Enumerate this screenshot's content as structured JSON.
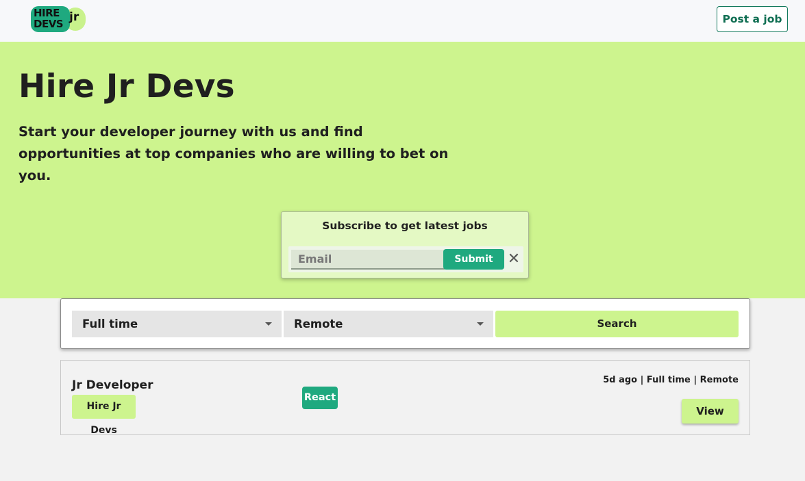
{
  "header": {
    "logo_text_line1": "HIRE",
    "logo_text_line2": "DEVS",
    "logo_badge": "jr",
    "post_job_label": "Post a job"
  },
  "hero": {
    "title": "Hire Jr Devs",
    "subtitle": "Start your developer journey with us and find opportunities at top companies who are willing to bet on you."
  },
  "subscribe": {
    "title": "Subscribe to get latest jobs",
    "email_placeholder": "Email",
    "email_value": "",
    "submit_label": "Submit",
    "close_icon": "close-icon"
  },
  "filters": {
    "job_type": "Full time",
    "location": "Remote",
    "search_label": "Search"
  },
  "jobs": [
    {
      "title": "Jr Developer",
      "company": "Hire Jr Devs",
      "tags": [
        "React"
      ],
      "meta": "5d ago | Full time | Remote",
      "view_label": "View"
    }
  ],
  "colors": {
    "accent_green": "#1fa97f",
    "lime": "#cdf48e",
    "dark_green_text": "#0f6e52"
  }
}
